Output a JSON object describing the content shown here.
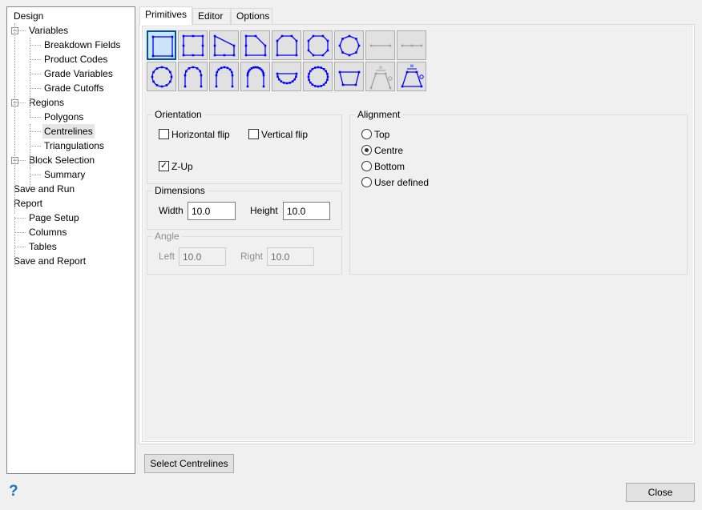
{
  "tree": {
    "items": [
      {
        "label": "Design",
        "level": 0
      },
      {
        "label": "Variables",
        "level": 1,
        "expander": "minus"
      },
      {
        "label": "Breakdown Fields",
        "level": 2
      },
      {
        "label": "Product Codes",
        "level": 2
      },
      {
        "label": "Grade Variables",
        "level": 2
      },
      {
        "label": "Grade Cutoffs",
        "level": 2
      },
      {
        "label": "Regions",
        "level": 1,
        "expander": "minus"
      },
      {
        "label": "Polygons",
        "level": 2
      },
      {
        "label": "Centrelines",
        "level": 2,
        "selected": true
      },
      {
        "label": "Triangulations",
        "level": 2
      },
      {
        "label": "Block Selection",
        "level": 1,
        "expander": "minus"
      },
      {
        "label": "Summary",
        "level": 2
      },
      {
        "label": "Save and Run",
        "level": 0
      },
      {
        "label": "Report",
        "level": 0
      },
      {
        "label": "Page Setup",
        "level": 1
      },
      {
        "label": "Columns",
        "level": 1
      },
      {
        "label": "Tables",
        "level": 1
      },
      {
        "label": "Save and Report",
        "level": 0
      }
    ]
  },
  "tabs": [
    {
      "label": "Primitives",
      "active": true
    },
    {
      "label": "Editor"
    },
    {
      "label": "Options"
    }
  ],
  "primitives": [
    "square-icon",
    "square-midpoints-icon",
    "trapezoid-icon",
    "chamfered-square-icon",
    "chamfer-top-icon",
    "octagon-icon",
    "octagon-rotated-icon",
    "line-icon",
    "line-midpoint-icon",
    "circle-icon",
    "arch-icon",
    "arch-dense-icon",
    "arch-densest-icon",
    "half-circle-icon",
    "circle-dense-icon",
    "trapezoid-inverted-icon",
    "trapezoid-width-angle-disabled-icon",
    "trapezoid-width-angle-icon"
  ],
  "orientation": {
    "title": "Orientation",
    "horizontal_flip": {
      "label": "Horizontal flip",
      "checked": false
    },
    "vertical_flip": {
      "label": "Vertical flip",
      "checked": false
    },
    "z_up": {
      "label": "Z-Up",
      "checked": true
    }
  },
  "dimensions": {
    "title": "Dimensions",
    "width_label": "Width",
    "width": "10.0",
    "height_label": "Height",
    "height": "10.0"
  },
  "angle": {
    "title": "Angle",
    "left_label": "Left",
    "left": "10.0",
    "right_label": "Right",
    "right": "10.0"
  },
  "alignment": {
    "title": "Alignment",
    "options": [
      "Top",
      "Centre",
      "Bottom",
      "User defined"
    ],
    "selected": "Centre"
  },
  "buttons": {
    "select": "Select Centrelines",
    "close": "Close",
    "help": "?"
  },
  "colors": {
    "icon": "#0000ff",
    "accent": "#005499"
  }
}
